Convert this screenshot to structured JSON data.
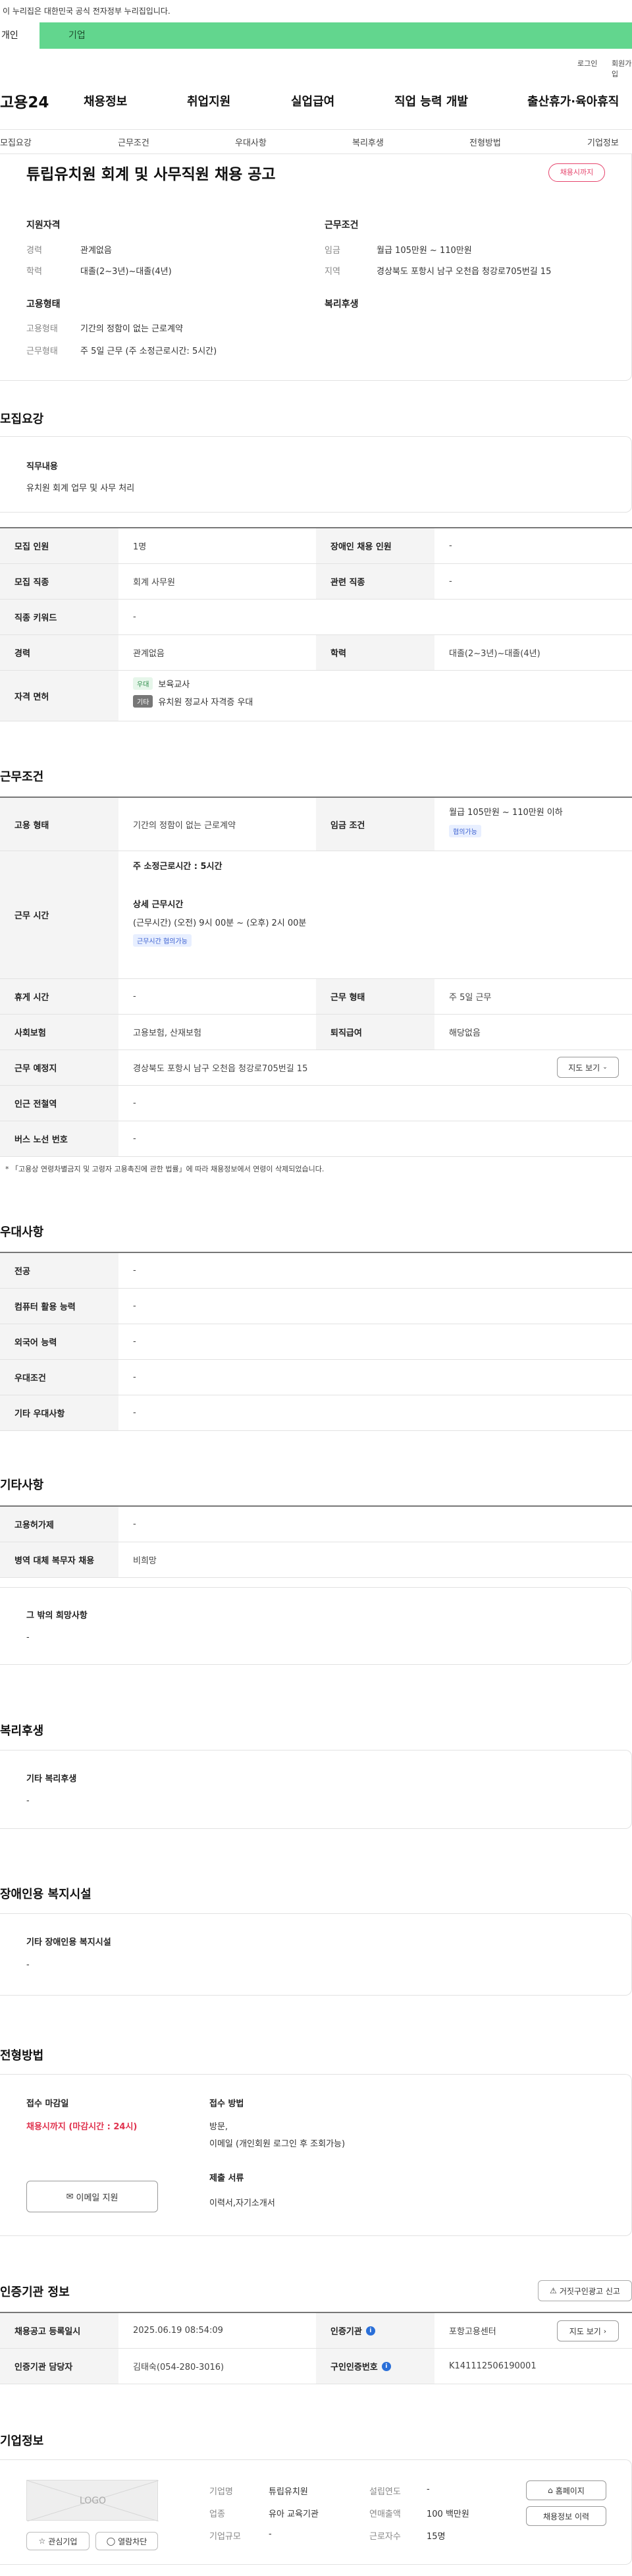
{
  "notice": {
    "text": "이 누리집은 대한민국 공식 전자정부 누리집입니다."
  },
  "service_tabs": {
    "tab1": "개인",
    "tab2": "기업"
  },
  "util": {
    "login": "로그인",
    "signup": "회원가입"
  },
  "header": {
    "logo": "고용24",
    "gnb": [
      "채용정보",
      "취업지원",
      "실업급여",
      "직업 능력 개발",
      "출산휴가·육아휴직"
    ]
  },
  "subnav": [
    "모집요강",
    "근무조건",
    "우대사항",
    "복리후생",
    "전형방법",
    "기업정보"
  ],
  "summary": {
    "title": "튜립유치원 회계 및 사무직원 채용 공고",
    "status": "채용시까지",
    "qual_title": "지원자격",
    "career_label": "경력",
    "career_value": "관계없음",
    "edu_label": "학력",
    "edu_value": "대졸(2~3년)~대졸(4년)",
    "work_title": "근무조건",
    "wage_label": "임금",
    "wage_value": "월급 105만원 ~ 110만원",
    "region_label": "지역",
    "region_value": "경상북도 포항시 남구 오천읍 청강로705번길 15",
    "emp_title": "고용형태",
    "emptype_label": "고용형태",
    "emptype_value": "기간의 정함이 없는 근로계약",
    "worktype_label": "근무형태",
    "worktype_value": "주 5일 근무 (주 소정근로시간: 5시간)",
    "welfare_title": "복리후생"
  },
  "recruit": {
    "section": "모집요강",
    "duty_title": "직무내용",
    "duty_text": "유치원 회계 업무 및 사무 처리",
    "rows": {
      "headcount_label": "모집 인원",
      "headcount_value": "1명",
      "disabled_label": "장애인 채용 인원",
      "disabled_value": "-",
      "job_label": "모집 직종",
      "job_value": "회계 사무원",
      "rel_label": "관련 직종",
      "rel_value": "-",
      "keyword_label": "직종 키워드",
      "keyword_value": "-",
      "career_label": "경력",
      "career_value": "관계없음",
      "edu_label": "학력",
      "edu_value": "대졸(2~3년)~대졸(4년)",
      "license_label": "자격 면허",
      "license1_tag": "우대",
      "license1_value": "보육교사",
      "license2_tag": "기타",
      "license2_value": "유치원 정교사 자격증 우대"
    }
  },
  "condition": {
    "section": "근무조건",
    "emp_label": "고용 형태",
    "emp_value": "기간의 정함이 없는 근로계약",
    "wage_label": "임금 조건",
    "wage_value": "월급 105만원 ~ 110만원 이하",
    "wage_chip": "협의가능",
    "hours_label": "근무 시간",
    "hours_weekly": "주 소정근로시간 : 5시간",
    "hours_detail_title": "상세 근무시간",
    "hours_detail": "(근무시간) (오전) 9시 00분 ~ (오후) 2시 00분",
    "hours_chip": "근무시간 협의가능",
    "rest_label": "휴게 시간",
    "rest_value": "-",
    "worktype_label": "근무 형태",
    "worktype_value": "주 5일 근무",
    "insurance_label": "사회보험",
    "insurance_value": "고용보험, 산재보험",
    "pension_label": "퇴직급여",
    "pension_value": "해당없음",
    "place_label": "근무 예정지",
    "place_value": "경상북도 포항시 남구 오천읍 청강로705번길 15",
    "map_btn": "지도 보기",
    "subway_label": "인근 전철역",
    "subway_value": "-",
    "bus_label": "버스 노선 번호",
    "bus_value": "-",
    "note": "* 「고용상 연령차별금지 및 고령자 고용촉진에 관한 법률」에 따라 채용정보에서 연령이 삭제되었습니다."
  },
  "preference": {
    "section": "우대사항",
    "major_label": "전공",
    "major_value": "-",
    "pc_label": "컴퓨터 활용 능력",
    "pc_value": "-",
    "lang_label": "외국어 능력",
    "lang_value": "-",
    "cond_label": "우대조건",
    "cond_value": "-",
    "etc_label": "기타 우대사항",
    "etc_value": "-"
  },
  "etc": {
    "section": "기타사항",
    "visa_label": "고용허가제",
    "visa_value": "-",
    "military_label": "병역 대체 복무자 채용",
    "military_value": "비희망",
    "other_title": "그 밖의 희망사항",
    "other_value": "-"
  },
  "welfare": {
    "section": "복리후생",
    "title": "기타 복리후생",
    "value": "-"
  },
  "disability": {
    "section": "장애인용 복지시설",
    "title": "기타 장애인용 복지시설",
    "value": "-"
  },
  "process": {
    "section": "전형방법",
    "deadline_title": "접수 마감일",
    "deadline_value": "채용시까지 (마감시간 : 24시)",
    "email_btn": "이메일 지원",
    "method_title": "접수 방법",
    "method_value1": "방문,",
    "method_value2": "이메일 (개인회원 로그인 후 조회가능)",
    "docs_title": "제출 서류",
    "docs_value": "이력서,자기소개서"
  },
  "certification": {
    "section": "인증기관 정보",
    "report_btn": "거짓구인광고 신고",
    "date_label": "채용공고 등록일시",
    "date_value": "2025.06.19 08:54:09",
    "agency_label": "인증기관",
    "agency_value": "포항고용센터",
    "map_btn": "지도 보기",
    "manager_label": "인증기관 담당자",
    "manager_value": "김태숙(054-280-3016)",
    "reqno_label": "구인인증번호",
    "reqno_value": "K141112506190001"
  },
  "company": {
    "section": "기업정보",
    "logo_text": "LOGO",
    "fav_btn": "관심기업",
    "block_btn": "열람차단",
    "name_label": "기업명",
    "name_value": "튜립유치원",
    "year_label": "설립연도",
    "year_value": "-",
    "industry_label": "업종",
    "industry_value": "유아 교육기관",
    "sales_label": "연매출액",
    "sales_value": "100 백만원",
    "scale_label": "기업규모",
    "scale_value": "-",
    "employees_label": "근로자수",
    "employees_value": "15명",
    "home_btn": "홈페이지",
    "history_btn": "채용정보 이력"
  }
}
